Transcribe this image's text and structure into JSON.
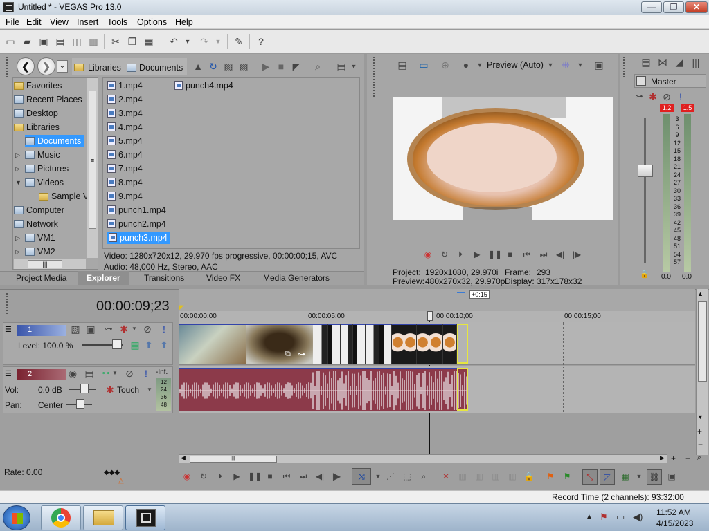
{
  "window": {
    "title": "Untitled * - VEGAS Pro 13.0",
    "minimize": "—",
    "maximize": "❐",
    "close": "✕"
  },
  "menu": [
    "File",
    "Edit",
    "View",
    "Insert",
    "Tools",
    "Options",
    "Help"
  ],
  "explorer": {
    "breadcrumb": [
      "Libraries",
      "Documents"
    ],
    "tree": [
      {
        "label": "Favorites",
        "indent": 0
      },
      {
        "label": "Recent Places",
        "indent": 0
      },
      {
        "label": "Desktop",
        "indent": 0
      },
      {
        "label": "Libraries",
        "indent": 0
      },
      {
        "label": "Documents",
        "indent": 1,
        "selected": true
      },
      {
        "label": "Music",
        "indent": 1
      },
      {
        "label": "Pictures",
        "indent": 1
      },
      {
        "label": "Videos",
        "indent": 1
      },
      {
        "label": "Sample V",
        "indent": 2
      },
      {
        "label": "Computer",
        "indent": 0
      },
      {
        "label": "Network",
        "indent": 0
      },
      {
        "label": "VM1",
        "indent": 1
      },
      {
        "label": "VM2",
        "indent": 1
      }
    ],
    "files_col1": [
      "1.mp4",
      "2.mp4",
      "3.mp4",
      "4.mp4",
      "5.mp4",
      "6.mp4",
      "7.mp4",
      "8.mp4",
      "9.mp4",
      "punch1.mp4",
      "punch2.mp4",
      "punch3.mp4"
    ],
    "files_col2": [
      "punch4.mp4"
    ],
    "selected_file": "punch3.mp4",
    "info_video": "Video: 1280x720x12, 29.970 fps progressive, 00:00:00;15, AVC",
    "info_audio": "Audio: 48,000 Hz, Stereo, AAC",
    "tabs": [
      "Project Media",
      "Explorer",
      "Transitions",
      "Video FX",
      "Media Generators"
    ],
    "active_tab": "Explorer"
  },
  "preview": {
    "mode": "Preview (Auto)",
    "project_label": "Project:",
    "project_value": "1920x1080, 29.970i",
    "preview_label": "Preview:",
    "preview_value": "480x270x32, 29.970p",
    "frame_label": "Frame:",
    "frame_value": "293",
    "display_label": "Display:",
    "display_value": "317x178x32"
  },
  "master": {
    "title": "Master",
    "peak_left": "1.2",
    "peak_right": "1.5",
    "scale": [
      "3",
      "6",
      "9",
      "12",
      "15",
      "18",
      "21",
      "24",
      "27",
      "30",
      "33",
      "36",
      "39",
      "42",
      "45",
      "48",
      "51",
      "54",
      "57"
    ],
    "bottom_left": "0.0",
    "bottom_right": "0.0"
  },
  "timeline": {
    "timecode": "00:00:09;23",
    "offset_badge": "+0:15",
    "ruler": [
      "00:00:00;00",
      "00:00:05;00",
      "00:00:10;00",
      "00:00:15;00"
    ],
    "track1": {
      "number": "1",
      "level_label": "Level: 100.0 %"
    },
    "track2": {
      "number": "2",
      "vol_label": "Vol:",
      "vol_value": "0.0 dB",
      "pan_label": "Pan:",
      "pan_value": "Center",
      "mode": "Touch",
      "inf": "-Inf.",
      "meter_scale": [
        "12",
        "24",
        "36",
        "48"
      ]
    },
    "rate": "Rate: 0.00",
    "record_time": "Record Time (2 channels): 93:32:00"
  },
  "taskbar": {
    "time": "11:52 AM",
    "date": "4/15/2023"
  },
  "colors": {
    "accent": "#3399ff",
    "audio": "#8c3a4a",
    "video_border": "#3344aa"
  }
}
